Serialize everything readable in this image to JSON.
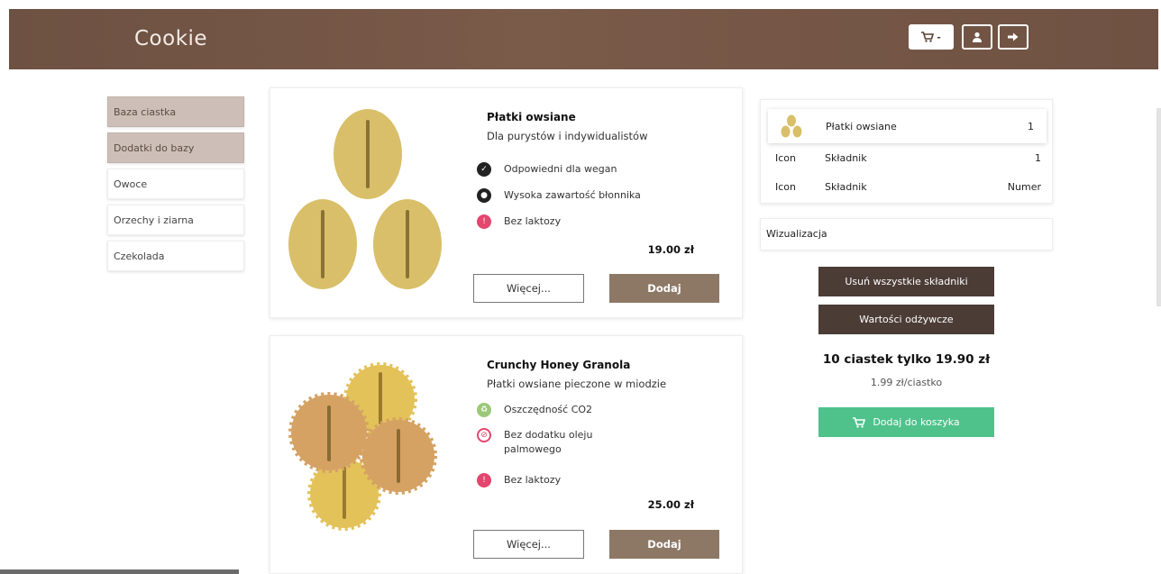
{
  "navbar": {
    "brand": "Cookie",
    "cart_label": "-",
    "icons": {
      "cart": "cart-icon",
      "user": "user-icon",
      "logout": "logout-icon"
    }
  },
  "sidebar": {
    "items": [
      {
        "label": "Baza ciastka",
        "active": true
      },
      {
        "label": "Dodatki do bazy",
        "active": true
      },
      {
        "label": "Owoce",
        "active": false
      },
      {
        "label": "Orzechy i ziarna",
        "active": false
      },
      {
        "label": "Czekolada",
        "active": false
      }
    ]
  },
  "products": [
    {
      "name": "Płatki owsiane",
      "description": "Dla purystów i indywidualistów",
      "features": [
        {
          "icon": "vegan-icon",
          "text": "Odpowiedni dla wegan"
        },
        {
          "icon": "fiber-icon",
          "text": "Wysoka zawartość błonnika"
        },
        {
          "icon": "no-lactose-icon",
          "text": "Bez laktozy"
        }
      ],
      "price": "19.00 zł",
      "more_label": "Więcej...",
      "add_label": "Dodaj"
    },
    {
      "name": "Crunchy Honey Granola",
      "description": "Płatki owsiane pieczone w miodzie",
      "features": [
        {
          "icon": "co2-icon",
          "text": "Oszczędność CO2"
        },
        {
          "icon": "no-palm-oil-icon",
          "text": "Bez dodatku oleju palmowego"
        },
        {
          "icon": "no-lactose-icon",
          "text": "Bez laktozy"
        }
      ],
      "price": "25.00 zł",
      "more_label": "Więcej...",
      "add_label": "Dodaj"
    }
  ],
  "summary": {
    "first": {
      "name": "Płatki owsiane",
      "qty": "1"
    },
    "rows": [
      {
        "c1": "Icon",
        "c2": "Składnik",
        "c3": "1"
      },
      {
        "c1": "Icon",
        "c2": "Składnik",
        "c3": "Numer"
      }
    ],
    "visualization_label": "Wizualizacja",
    "remove_all_label": "Usuń wszystkie składniki",
    "nutrition_label": "Wartości odżywcze",
    "promo": "10 ciastek tylko 19.90 zł",
    "promo_sub": "1.99 zł/ciastko",
    "add_to_cart_label": "Dodaj do koszyka"
  },
  "colors": {
    "navbar": "#6d5142",
    "sidebar_active": "#cdbfb8",
    "add_button": "#8d7866",
    "dark_button": "#4b3c36",
    "cart_button": "#4fc28c",
    "oat": "#d9bf6a",
    "granola": "#d5a264"
  }
}
